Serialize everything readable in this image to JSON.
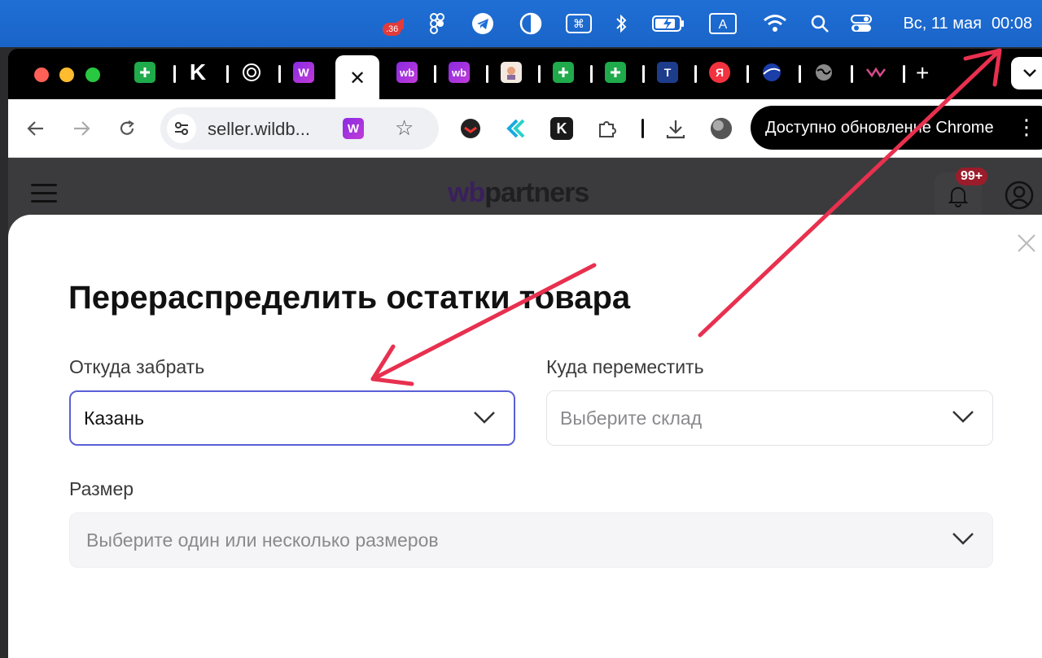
{
  "menubar": {
    "notification_count": ".36",
    "date": "Вс, 11 мая",
    "time": "00:08",
    "keyboard_layout": "A"
  },
  "tabs": {
    "active_close": "✕",
    "new_tab": "+"
  },
  "toolbar": {
    "url": "seller.wildb...",
    "ext_letter": "W",
    "update_label": "Доступно обновление Chrome"
  },
  "page": {
    "logo_wb": "wb",
    "logo_rest": "partners",
    "notifications_badge": "99+"
  },
  "modal": {
    "title": "Перераспределить остатки товара",
    "from": {
      "label": "Откуда забрать",
      "value": "Казань"
    },
    "to": {
      "label": "Куда переместить",
      "placeholder": "Выберите склад"
    },
    "size": {
      "label": "Размер",
      "placeholder": "Выберите один или несколько размеров"
    }
  },
  "colors": {
    "menubar": "#1f6fd6",
    "select_focus": "#5a5fd6",
    "arrow": "#e8304f",
    "wb_brand": "#8a2be2"
  }
}
